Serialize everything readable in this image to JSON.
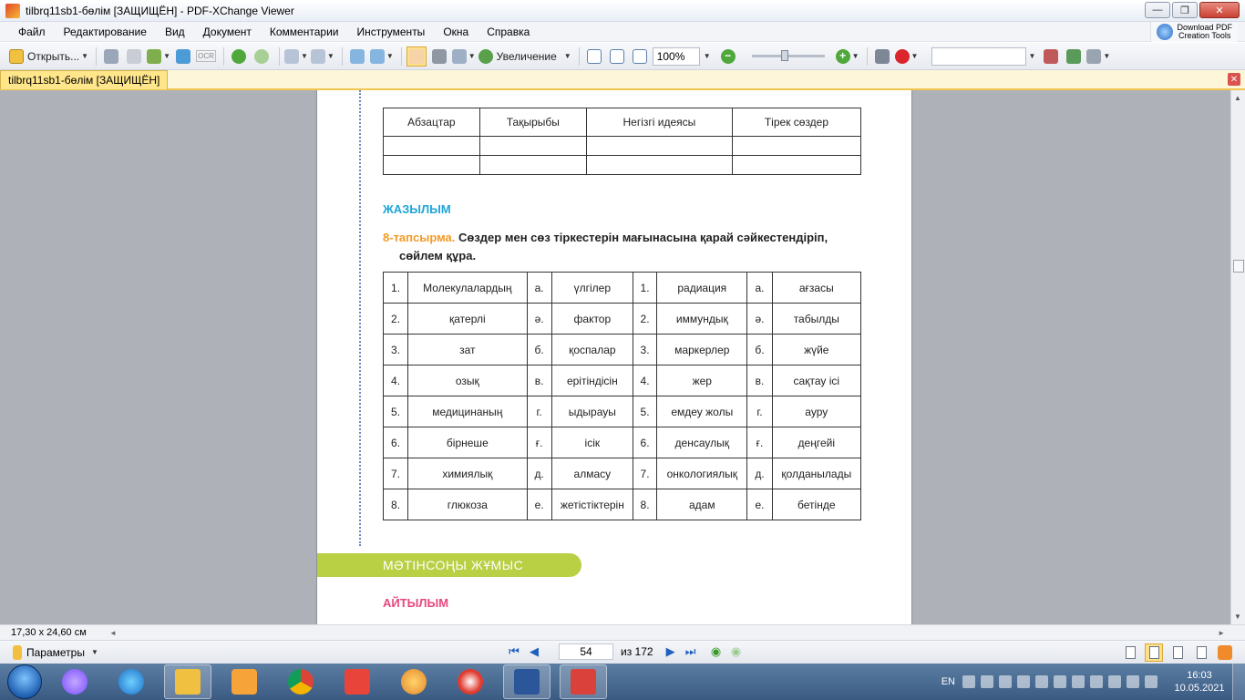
{
  "window": {
    "title": "tilbrq11sb1-бөлім [ЗАЩИЩЁН] - PDF-XChange Viewer",
    "minimize": "—",
    "restore": "❐",
    "close": "✕"
  },
  "menu": [
    "Файл",
    "Редактирование",
    "Вид",
    "Документ",
    "Комментарии",
    "Инструменты",
    "Окна",
    "Справка"
  ],
  "download_pdf": {
    "line1": "Download PDF",
    "line2": "Creation Tools"
  },
  "toolbar": {
    "open_label": "Открыть...",
    "ocr_label": "OCR",
    "zoom_label": "Увеличение",
    "zoom_value": "100%",
    "minus": "−",
    "plus": "+"
  },
  "tab": {
    "label": "tilbrq11sb1-бөлім [ЗАЩИЩЁН]",
    "close": "✕"
  },
  "document": {
    "table1": {
      "headers": [
        "Абзацтар",
        "Тақырыбы",
        "Негізгі идеясы",
        "Тірек сөздер"
      ],
      "rows": [
        [
          "",
          "",
          "",
          ""
        ],
        [
          "",
          "",
          "",
          ""
        ]
      ]
    },
    "section_writing": "ЖАЗЫЛЫМ",
    "task": {
      "number": "8",
      "label_rest": "-тапсырма.",
      "text_line1": " Сөздер мен сөз тіркестерін мағынасына қарай сәйкестендіріп,",
      "text_line2": "сөйлем құра."
    },
    "table2": [
      [
        "1.",
        "Молекулалардың",
        "а.",
        "үлгілер",
        "1.",
        "радиация",
        "а.",
        "ағзасы"
      ],
      [
        "2.",
        "қатерлі",
        "ә.",
        "фактор",
        "2.",
        "иммундық",
        "ә.",
        "табылды"
      ],
      [
        "3.",
        "зат",
        "б.",
        "қоспалар",
        "3.",
        "маркерлер",
        "б.",
        "жүйе"
      ],
      [
        "4.",
        "озық",
        "в.",
        "ерітіндісін",
        "4.",
        "жер",
        "в.",
        "сақтау ісі"
      ],
      [
        "5.",
        "медицинаның",
        "г.",
        "ыдырауы",
        "5.",
        "емдеу жолы",
        "г.",
        "ауру"
      ],
      [
        "6.",
        "бірнеше",
        "ғ.",
        "ісік",
        "6.",
        "денсаулық",
        "ғ.",
        "деңгейі"
      ],
      [
        "7.",
        "химиялық",
        "д.",
        "алмасу",
        "7.",
        "онкологиялық",
        "д.",
        "қолданылады"
      ],
      [
        "8.",
        "глюкоза",
        "е.",
        "жетістіктерін",
        "8.",
        "адам",
        "е.",
        "бетінде"
      ]
    ],
    "band_title": "МӘТІНСОҢЫ ЖҰМЫС",
    "section_speaking": "АЙТЫЛЫМ",
    "colors": {
      "section_blue": "#1fa6d8",
      "task_orange": "#f39a27",
      "band_green": "#b9cf44",
      "section_pink": "#e8477e"
    }
  },
  "status": {
    "page_size": "17,30 x 24,60 см"
  },
  "nav": {
    "params_label": "Параметры",
    "current_page": "54",
    "total_pages": "из 172"
  },
  "taskbar": {
    "lang": "EN",
    "time": "16:03",
    "date": "10.05.2021"
  }
}
